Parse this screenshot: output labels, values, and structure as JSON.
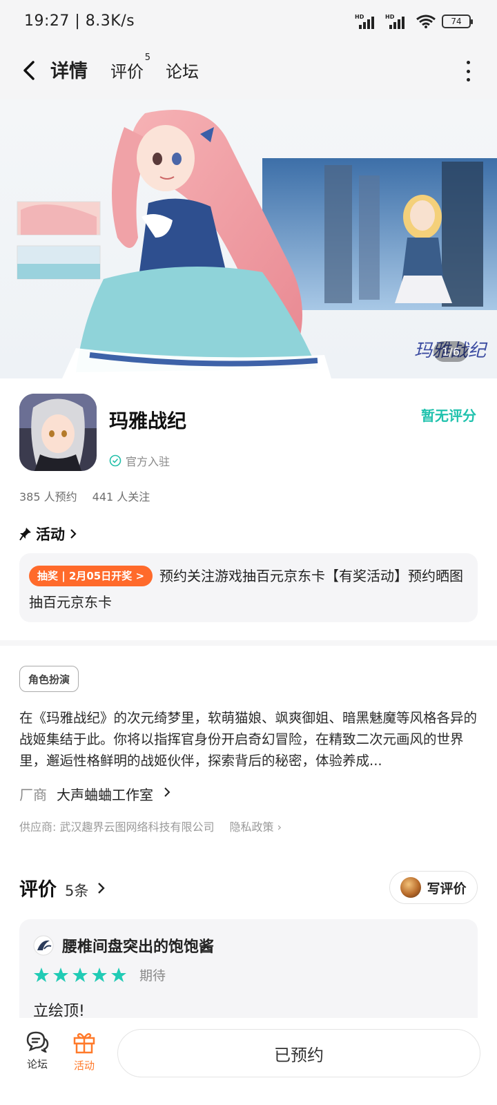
{
  "status_bar": {
    "time": "19:27 | 8.3K/s",
    "signal_label": "HD",
    "battery": "74"
  },
  "nav": {
    "tabs": [
      {
        "label": "详情",
        "active": true
      },
      {
        "label": "评价",
        "badge": "5"
      },
      {
        "label": "论坛"
      }
    ]
  },
  "banner": {
    "pager": "1/6",
    "icon": "game-banner-illustration"
  },
  "app": {
    "name": "玛雅战纪",
    "official": "官方入驻",
    "rating": "暂无评分",
    "reservations": "385 人预约",
    "followers": "441 人关注"
  },
  "activity": {
    "heading": "活动",
    "badge": "抽奖 | 2月05日开奖 >",
    "text": "预约关注游戏抽百元京东卡【有奖活动】预约晒图抽百元京东卡"
  },
  "details": {
    "genre": "角色扮演",
    "description": "在《玛雅战纪》的次元绮梦里，软萌猫娘、飒爽御姐、暗黑魅魔等风格各异的战姬集结于此。你将以指挥官身份开启奇幻冒险，在精致二次元画风的世界里，邂逅性格鲜明的战姬伙伴，探索背后的秘密，体验养成...",
    "vendor_label": "厂商",
    "vendor_name": "大声蛐蛐工作室",
    "supplier": "供应商: 武汉趣界云图网络科技有限公司",
    "privacy": "隐私政策"
  },
  "reviews": {
    "title": "评价",
    "count": "5条",
    "write_button": "写评价",
    "items": [
      {
        "user": "腰椎间盘突出的饱饱酱",
        "stars": 5,
        "tag": "期待",
        "text": "立绘顶!"
      }
    ]
  },
  "bottom_bar": {
    "forum_label": "论坛",
    "event_label": "活动",
    "reserve_button": "已预约"
  },
  "colors": {
    "accent": "#22cbb6",
    "orange": "#ff6a2b",
    "background": "#ffffff"
  }
}
